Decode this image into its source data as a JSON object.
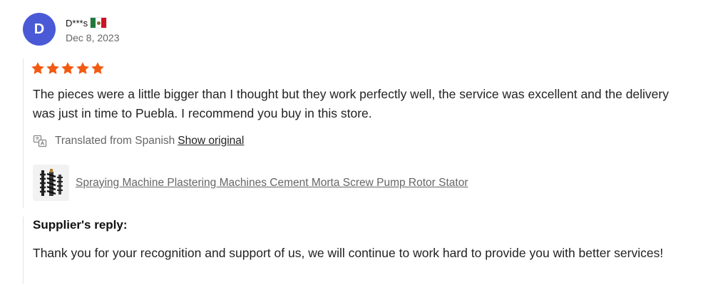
{
  "reviewer": {
    "initial": "D",
    "name": "D***s",
    "flag_icon": "mexico-flag-icon",
    "date": "Dec 8, 2023",
    "avatar_color": "#4a5ad6"
  },
  "review": {
    "rating": 5,
    "rating_max": 5,
    "star_icon": "star-icon",
    "star_color": "#f25a12",
    "text": "The pieces were a little bigger than I thought but they work perfectly well, the service was excellent and the delivery was just in time to Puebla. I recommend you buy in this store.",
    "translation_label": "Translated from Spanish",
    "translation_icon": "translate-icon",
    "show_original_label": "Show original"
  },
  "product": {
    "thumbnail_icon": "screw-rotor-icon",
    "title": "Spraying Machine Plastering Machines Cement Morta Screw Pump Rotor Stator"
  },
  "supplier_reply": {
    "heading": "Supplier's reply:",
    "text": "Thank you for your recognition and support of us, we will continue to work hard to provide you with better services!"
  }
}
